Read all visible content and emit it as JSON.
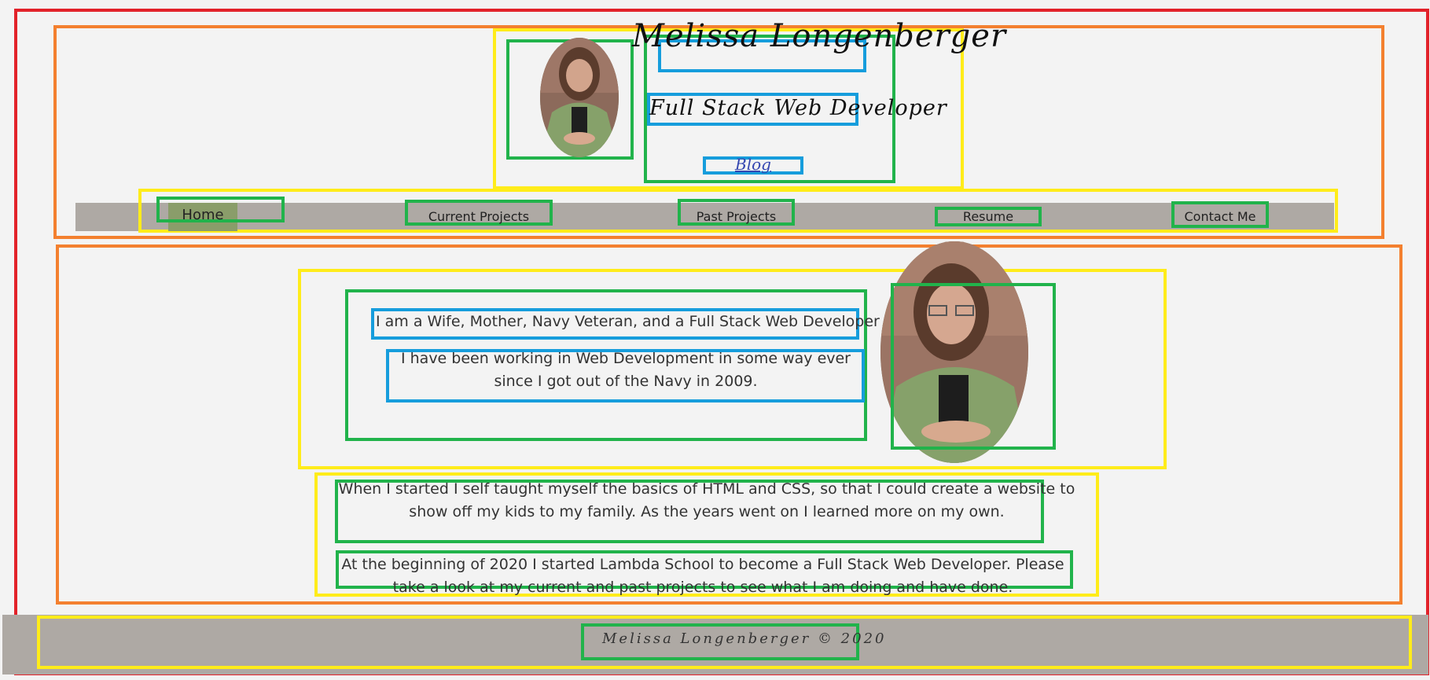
{
  "header": {
    "title": "Melissa Longenberger",
    "subtitle": "Full Stack Web Developer",
    "blog_link": "Blog"
  },
  "nav": {
    "items": [
      {
        "label": "Home",
        "active": true
      },
      {
        "label": "Current Projects",
        "active": false
      },
      {
        "label": "Past Projects",
        "active": false
      },
      {
        "label": "Resume",
        "active": false
      },
      {
        "label": "Contact Me",
        "active": false
      }
    ]
  },
  "main": {
    "intro": "I am a Wife, Mother, Navy Veteran, and a Full Stack Web Developer",
    "paragraph_1": "I have been working in Web Development in some way ever since I got out of the Navy in 2009.",
    "paragraph_2": "When I started I self taught myself the basics of HTML and CSS, so that I could create a website to show off my kids to my family. As the years went on I learned more on my own.",
    "paragraph_3": "At the beginning of 2020 I started Lambda School to become a Full Stack Web Developer. Please take a look at my current and past projects to see what I am doing and have done."
  },
  "footer": {
    "text": "Melissa Longenberger © 2020"
  },
  "colors": {
    "page_bg": "#f3f3f3",
    "nav_bg": "#aea9a4",
    "nav_active_bg": "#8a9d6a",
    "link_color": "#3446b0"
  }
}
